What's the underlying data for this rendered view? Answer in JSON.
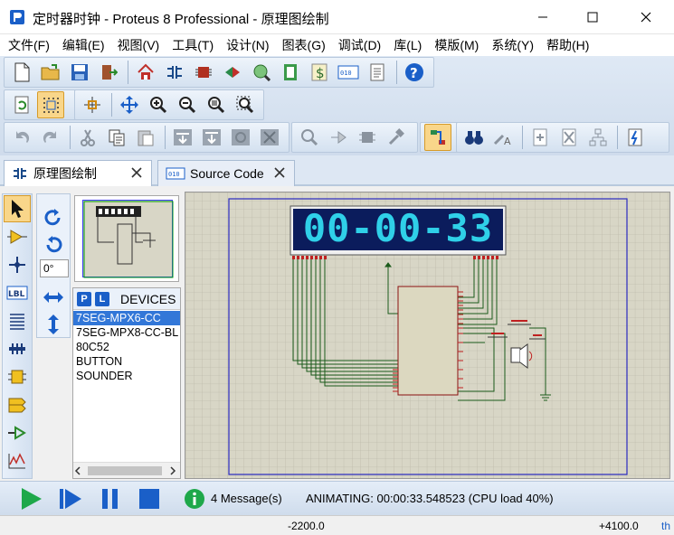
{
  "window": {
    "title": "定时器时钟 - Proteus 8 Professional - 原理图绘制"
  },
  "menu": [
    "文件(F)",
    "编辑(E)",
    "视图(V)",
    "工具(T)",
    "设计(N)",
    "图表(G)",
    "调试(D)",
    "库(L)",
    "模版(M)",
    "系统(Y)",
    "帮助(H)"
  ],
  "tabs": [
    {
      "label": "原理图绘制",
      "icon": "schematic-icon",
      "active": true
    },
    {
      "label": "Source Code",
      "icon": "source-code-icon",
      "active": false
    }
  ],
  "rotation": {
    "angle": "0°"
  },
  "devices": {
    "badges": [
      "P",
      "L"
    ],
    "title": "DEVICES",
    "items": [
      "7SEG-MPX6-CC",
      "7SEG-MPX8-CC-BL",
      "80C52",
      "BUTTON",
      "SOUNDER"
    ],
    "selected_index": 0
  },
  "schematic": {
    "display_text": "00-00-33"
  },
  "simulation": {
    "message_count": "4 Message(s)",
    "status": "ANIMATING: 00:00:33.548523 (CPU load 40%)"
  },
  "statusbar": {
    "x": "-2200.0",
    "y": "+4100.0",
    "unit": "th"
  },
  "colors": {
    "accent": "#1a5fc8",
    "display_bg": "#0b1c5c",
    "display_seg": "#2fd0e8",
    "canvas_bg": "#d8d6c6",
    "wire": "#1a5a1a"
  }
}
